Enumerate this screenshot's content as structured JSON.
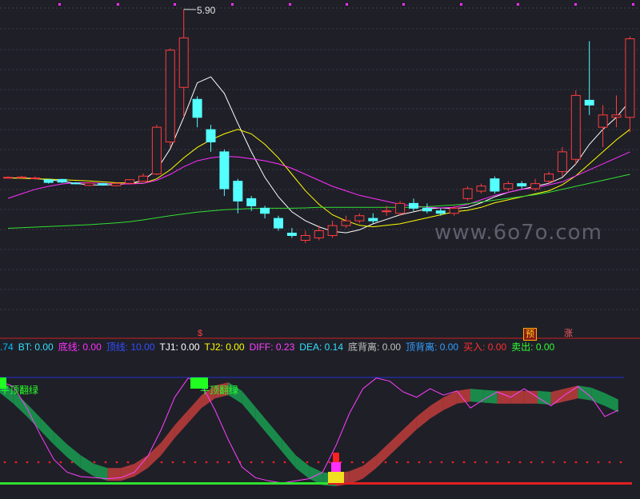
{
  "chart_data": {
    "type": "candlestick",
    "price_panel": {
      "peak_label": "5.90",
      "candles": [
        {
          "o": 0.3,
          "c": 0.3,
          "h": 0.33,
          "l": 0.28
        },
        {
          "o": 0.3,
          "c": 0.31,
          "h": 0.34,
          "l": 0.28
        },
        {
          "o": 0.26,
          "c": 0.28,
          "h": 0.33,
          "l": 0.25
        },
        {
          "o": 0.22,
          "c": 0.13,
          "h": 0.23,
          "l": 0.09
        },
        {
          "o": 0.23,
          "c": 0.14,
          "h": 0.25,
          "l": 0.11
        },
        {
          "o": 0.11,
          "c": 0.1,
          "h": 0.14,
          "l": 0.07
        },
        {
          "o": 0.03,
          "c": 0.11,
          "h": 0.13,
          "l": 0.01
        },
        {
          "o": 0.09,
          "c": 0.04,
          "h": 0.11,
          "l": 0.02
        },
        {
          "o": 0.02,
          "c": 0.1,
          "h": 0.12,
          "l": 0.0
        },
        {
          "o": 0.1,
          "c": 0.22,
          "h": 0.24,
          "l": 0.08
        },
        {
          "o": 0.17,
          "c": 0.34,
          "h": 0.43,
          "l": 0.15
        },
        {
          "o": 0.41,
          "c": 1.97,
          "h": 2.05,
          "l": 0.37
        },
        {
          "o": 1.48,
          "c": 4.54,
          "h": 4.6,
          "l": 1.31
        },
        {
          "o": 3.3,
          "c": 4.95,
          "h": 5.9,
          "l": 2.3
        },
        {
          "o": 2.9,
          "c": 2.3,
          "h": 3.0,
          "l": 1.97
        },
        {
          "o": 1.89,
          "c": 1.48,
          "h": 2.05,
          "l": 1.15
        },
        {
          "o": 1.15,
          "c": -0.08,
          "h": 1.23,
          "l": -0.32
        },
        {
          "o": 0.17,
          "c": -0.49,
          "h": 0.25,
          "l": -0.9
        },
        {
          "o": -0.41,
          "c": -0.65,
          "h": -0.32,
          "l": -0.82
        },
        {
          "o": -0.73,
          "c": -0.9,
          "h": -0.65,
          "l": -1.07
        },
        {
          "o": -1.07,
          "c": -1.39,
          "h": -0.98,
          "l": -1.48
        },
        {
          "o": -1.56,
          "c": -1.64,
          "h": -1.39,
          "l": -1.72
        },
        {
          "o": -1.8,
          "c": -1.64,
          "h": -1.48,
          "l": -1.89
        },
        {
          "o": -1.72,
          "c": -1.48,
          "h": -1.31,
          "l": -1.8
        },
        {
          "o": -1.64,
          "c": -1.31,
          "h": -1.15,
          "l": -1.72
        },
        {
          "o": -1.31,
          "c": -1.15,
          "h": -0.98,
          "l": -1.39
        },
        {
          "o": -1.15,
          "c": -0.98,
          "h": -0.9,
          "l": -1.23
        },
        {
          "o": -1.07,
          "c": -1.15,
          "h": -0.9,
          "l": -1.23
        },
        {
          "o": -0.82,
          "c": -0.82,
          "h": -0.65,
          "l": -0.98
        },
        {
          "o": -0.9,
          "c": -0.57,
          "h": -0.49,
          "l": -0.98
        },
        {
          "o": -0.57,
          "c": -0.73,
          "h": -0.41,
          "l": -0.82
        },
        {
          "o": -0.73,
          "c": -0.82,
          "h": -0.57,
          "l": -0.9
        },
        {
          "o": -0.82,
          "c": -0.9,
          "h": -0.73,
          "l": -0.98
        },
        {
          "o": -0.9,
          "c": -0.73,
          "h": -0.65,
          "l": -0.98
        },
        {
          "o": -0.41,
          "c": -0.08,
          "h": 0.0,
          "l": -0.49
        },
        {
          "o": -0.16,
          "c": 0.01,
          "h": 0.09,
          "l": -0.24
        },
        {
          "o": 0.25,
          "c": -0.16,
          "h": 0.33,
          "l": -0.24
        },
        {
          "o": -0.08,
          "c": 0.09,
          "h": 0.17,
          "l": -0.16
        },
        {
          "o": 0.09,
          "c": 0.01,
          "h": 0.17,
          "l": -0.08
        },
        {
          "o": -0.08,
          "c": 0.09,
          "h": 0.25,
          "l": -0.16
        },
        {
          "o": 0.17,
          "c": 0.41,
          "h": 0.49,
          "l": 0.09
        },
        {
          "o": 0.49,
          "c": 1.15,
          "h": 1.31,
          "l": 0.33
        },
        {
          "o": 0.9,
          "c": 3.03,
          "h": 3.2,
          "l": 0.74
        },
        {
          "o": 2.87,
          "c": 2.71,
          "h": 4.84,
          "l": 2.38
        },
        {
          "o": 1.97,
          "c": 2.38,
          "h": 2.71,
          "l": 1.31
        },
        {
          "o": 2.3,
          "c": 2.38,
          "h": 3.03,
          "l": 1.97
        },
        {
          "o": 2.3,
          "c": 4.92,
          "h": 5.0,
          "l": 1.8
        }
      ],
      "ma_lines": [
        {
          "name": "MA5",
          "color": "#ffffff",
          "values": [
            0.28,
            0.28,
            0.26,
            0.22,
            0.17,
            0.1,
            0.05,
            0.04,
            0.06,
            0.09,
            0.2,
            0.55,
            1.25,
            2.3,
            3.45,
            3.65,
            3.1,
            2.1,
            1.15,
            0.3,
            -0.35,
            -0.85,
            -1.15,
            -1.35,
            -1.5,
            -1.55,
            -1.45,
            -1.25,
            -1.1,
            -0.95,
            -0.85,
            -0.75,
            -0.72,
            -0.74,
            -0.7,
            -0.55,
            -0.35,
            -0.2,
            -0.1,
            0.0,
            0.1,
            0.3,
            0.75,
            1.4,
            1.9,
            2.3,
            2.85
          ]
        },
        {
          "name": "MA10",
          "color": "#ffff00",
          "values": [
            0.28,
            0.27,
            0.25,
            0.24,
            0.22,
            0.2,
            0.18,
            0.15,
            0.12,
            0.11,
            0.1,
            0.25,
            0.55,
            0.95,
            1.3,
            1.55,
            1.75,
            1.9,
            1.75,
            1.4,
            0.95,
            0.4,
            -0.15,
            -0.6,
            -0.95,
            -1.15,
            -1.3,
            -1.35,
            -1.3,
            -1.25,
            -1.15,
            -1.05,
            -0.95,
            -0.85,
            -0.8,
            -0.7,
            -0.55,
            -0.45,
            -0.35,
            -0.25,
            -0.15,
            0.05,
            0.35,
            0.75,
            1.15,
            1.55,
            1.9
          ]
        },
        {
          "name": "MA20",
          "color": "#ff30ff",
          "values": [
            -0.4,
            -0.25,
            -0.1,
            0.0,
            0.08,
            0.12,
            0.12,
            0.1,
            0.08,
            0.08,
            0.1,
            0.2,
            0.4,
            0.65,
            0.85,
            0.95,
            1.0,
            0.98,
            0.92,
            0.85,
            0.75,
            0.6,
            0.4,
            0.2,
            0.0,
            -0.15,
            -0.3,
            -0.4,
            -0.5,
            -0.6,
            -0.65,
            -0.7,
            -0.72,
            -0.7,
            -0.6,
            -0.45,
            -0.3,
            -0.2,
            -0.1,
            -0.05,
            0.05,
            0.15,
            0.35,
            0.55,
            0.75,
            0.95,
            1.15
          ]
        },
        {
          "name": "MA60",
          "color": "#30e030",
          "values": [
            -1.4,
            -1.38,
            -1.36,
            -1.34,
            -1.32,
            -1.3,
            -1.28,
            -1.25,
            -1.22,
            -1.18,
            -1.12,
            -1.05,
            -0.98,
            -0.92,
            -0.86,
            -0.82,
            -0.78,
            -0.76,
            -0.74,
            -0.73,
            -0.73,
            -0.73,
            -0.72,
            -0.7,
            -0.7,
            -0.7,
            -0.7,
            -0.7,
            -0.7,
            -0.7,
            -0.7,
            -0.68,
            -0.65,
            -0.62,
            -0.58,
            -0.52,
            -0.46,
            -0.4,
            -0.34,
            -0.28,
            -0.2,
            -0.1,
            0.0,
            0.1,
            0.2,
            0.3,
            0.4
          ]
        }
      ]
    },
    "indicator_panel": {
      "macd_ribbon": [
        0.9,
        0.8,
        0.68,
        0.55,
        0.42,
        0.3,
        0.2,
        0.12,
        0.08,
        0.08,
        0.12,
        0.2,
        0.32,
        0.48,
        0.62,
        0.76,
        0.85,
        0.88,
        0.8,
        0.65,
        0.5,
        0.35,
        0.2,
        0.1,
        0.04,
        0.03,
        0.05,
        0.1,
        0.2,
        0.32,
        0.44,
        0.56,
        0.66,
        0.74,
        0.8,
        0.82,
        0.81,
        0.8,
        0.8,
        0.8,
        0.8,
        0.79,
        0.82,
        0.85,
        0.83,
        0.78,
        0.72
      ],
      "magenta_line": [
        0.95,
        0.9,
        0.7,
        0.45,
        0.22,
        0.1,
        0.06,
        0.05,
        0.04,
        0.05,
        0.1,
        0.25,
        0.5,
        0.8,
        0.98,
        0.92,
        0.68,
        0.4,
        0.15,
        0.05,
        0.02,
        0.0,
        0.02,
        0.04,
        0.1,
        0.35,
        0.65,
        0.88,
        0.98,
        0.95,
        0.85,
        0.8,
        0.88,
        0.82,
        0.86,
        0.7,
        0.78,
        0.85,
        0.8,
        0.88,
        0.8,
        0.72,
        0.82,
        0.9,
        0.8,
        0.62,
        0.68
      ],
      "flip_labels": [
        "平顶翻绿",
        "平顶翻绿"
      ]
    },
    "legend": [
      {
        "name": ".74",
        "value": "",
        "color": "#00c0ff"
      },
      {
        "name": "BT:",
        "value": "0.00",
        "color": "#30e0ff"
      },
      {
        "name": "底线:",
        "value": "0.00",
        "color": "#ff30ff"
      },
      {
        "name": "顶线:",
        "value": "10.00",
        "color": "#3050ff"
      },
      {
        "name": "TJ1:",
        "value": "0.00",
        "color": "#ffffff"
      },
      {
        "name": "TJ2:",
        "value": "0.00",
        "color": "#ffff00"
      },
      {
        "name": "DIFF:",
        "value": "0.23",
        "color": "#ff40ff"
      },
      {
        "name": "DEA:",
        "value": "0.14",
        "color": "#30e0ff"
      },
      {
        "name": "底背离:",
        "value": "0.00",
        "color": "#c0c0c0"
      },
      {
        "name": "顶背离:",
        "value": "0.00",
        "color": "#30a0ff"
      },
      {
        "name": "买入:",
        "value": "0.00",
        "color": "#ff3030"
      },
      {
        "name": "卖出:",
        "value": "0.00",
        "color": "#30ff30"
      }
    ],
    "markers": {
      "s": "$",
      "yu": "预",
      "zhang": "涨"
    }
  },
  "watermark": "www.6o7o.com"
}
